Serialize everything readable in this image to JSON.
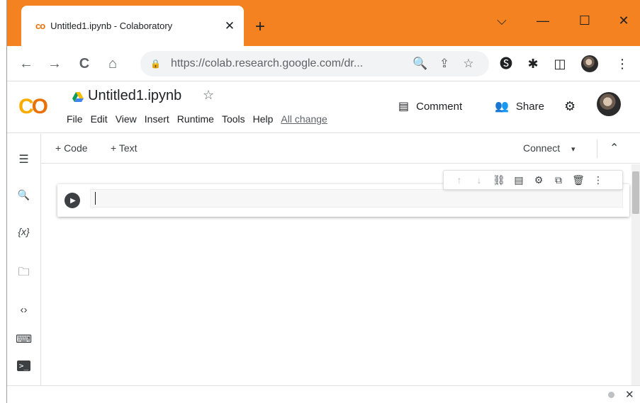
{
  "browser": {
    "tab": {
      "favicon": "co",
      "title": "Untitled1.ipynb - Colaboratory",
      "close": "✕"
    },
    "new_tab": "+",
    "window_controls": {
      "tabsearch": "⌵",
      "minimize": "—",
      "maximize": "☐",
      "close": "✕"
    },
    "nav": {
      "back": "←",
      "forward": "→",
      "reload": "C",
      "home": "⌂"
    },
    "address": {
      "lock": "🔒",
      "url": "https://colab.research.google.com/dr...",
      "zoom": "🔍",
      "share": "⇪",
      "bookmark": "☆"
    },
    "toolbar_icons": {
      "extension_s": "🅢",
      "extensions": "✱",
      "sidepanel": "◫",
      "menu": "⋮"
    }
  },
  "colab": {
    "logo": "CO",
    "notebook_title": "Untitled1.ipynb",
    "star": "☆",
    "menu": [
      "File",
      "Edit",
      "View",
      "Insert",
      "Runtime",
      "Tools",
      "Help"
    ],
    "all_changes": "All changes saved",
    "comment_label": "Comment",
    "share_label": "Share",
    "settings": "⚙",
    "comment_icon": "▤",
    "share_icon": "👥"
  },
  "sidebar": {
    "items": [
      {
        "name": "table-of-contents-icon",
        "glyph": "☰"
      },
      {
        "name": "search-icon",
        "glyph": "🔍"
      },
      {
        "name": "variables-icon",
        "glyph": "{x}"
      },
      {
        "name": "files-icon",
        "glyph": "🗀"
      },
      {
        "name": "code-snippets-icon",
        "glyph": "‹›"
      },
      {
        "name": "command-palette-icon",
        "glyph": "⌨"
      },
      {
        "name": "terminal-icon",
        "glyph": ">_"
      }
    ]
  },
  "toolbar": {
    "add_code": "+ Code",
    "add_text": "+ Text",
    "connect": "Connect",
    "connect_arrow": "▾",
    "collapse": "⌃"
  },
  "cell": {
    "run": "▶",
    "toolbar": [
      "↑",
      "↓",
      "⛓",
      "▤",
      "⚙",
      "⧉",
      "🗑",
      "⋮"
    ]
  },
  "statusbar": {
    "close": "✕"
  }
}
